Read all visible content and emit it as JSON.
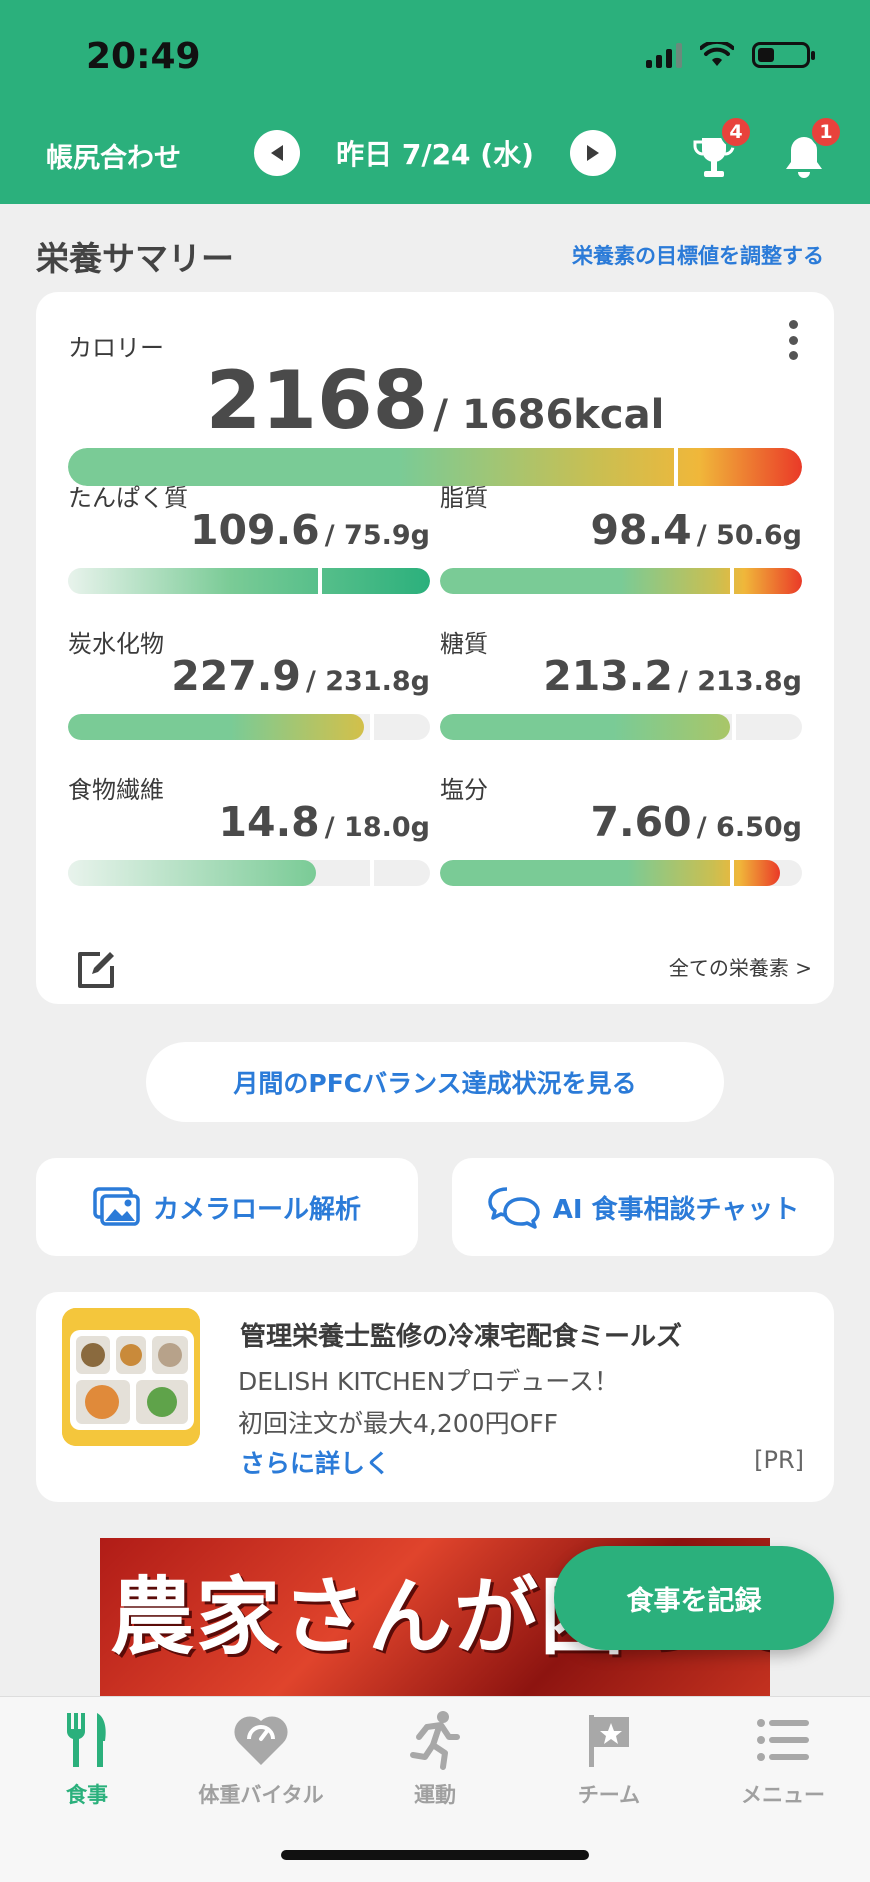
{
  "status": {
    "time": "20:49"
  },
  "header": {
    "left_label": "帳尻合わせ",
    "date": "昨日 7/24 (水)",
    "trophy_badge": "4",
    "bell_badge": "1"
  },
  "summary": {
    "title": "栄養サマリー",
    "adjust_link": "栄養素の目標値を調整する",
    "calorie": {
      "label": "カロリー",
      "value": "2168",
      "goal": "/ 1686kcal",
      "progress": 1.29
    },
    "nutrients": [
      {
        "label": "たんぱく質",
        "value": "109.6",
        "goal": "/ 75.9g",
        "progress": 1.44
      },
      {
        "label": "脂質",
        "value": "98.4",
        "goal": "/ 50.6g",
        "progress": 1.94
      },
      {
        "label": "炭水化物",
        "value": "227.9",
        "goal": "/ 231.8g",
        "progress": 0.98
      },
      {
        "label": "糖質",
        "value": "213.2",
        "goal": "/ 213.8g",
        "progress": 1.0
      },
      {
        "label": "食物繊維",
        "value": "14.8",
        "goal": "/ 18.0g",
        "progress": 0.82
      },
      {
        "label": "塩分",
        "value": "7.60",
        "goal": "/ 6.50g",
        "progress": 1.17
      }
    ],
    "all_nutrients_link": "全ての栄養素 >"
  },
  "pfc_button": "月間のPFCバランス達成状況を見る",
  "actions": {
    "camera": "カメラロール解析",
    "chat": "AI 食事相談チャット"
  },
  "ad": {
    "title": "管理栄養士監修の冷凍宅配食ミールズ",
    "line1": "DELISH KITCHENプロデュース！",
    "line2": "初回注文が最大4,200円OFF",
    "more": "さらに詳しく",
    "pr": "[PR]"
  },
  "banner": {
    "text": "農家さんが困っています"
  },
  "record_button": "食事を記録",
  "tabs": [
    {
      "label": "食事",
      "icon": "fork-knife-icon"
    },
    {
      "label": "体重バイタル",
      "icon": "heart-scale-icon"
    },
    {
      "label": "運動",
      "icon": "runner-icon"
    },
    {
      "label": "チーム",
      "icon": "flag-star-icon"
    },
    {
      "label": "メニュー",
      "icon": "list-menu-icon"
    }
  ],
  "colors": {
    "brand": "#2bb07c",
    "link": "#2b7bd8",
    "badge": "#e8423c"
  }
}
